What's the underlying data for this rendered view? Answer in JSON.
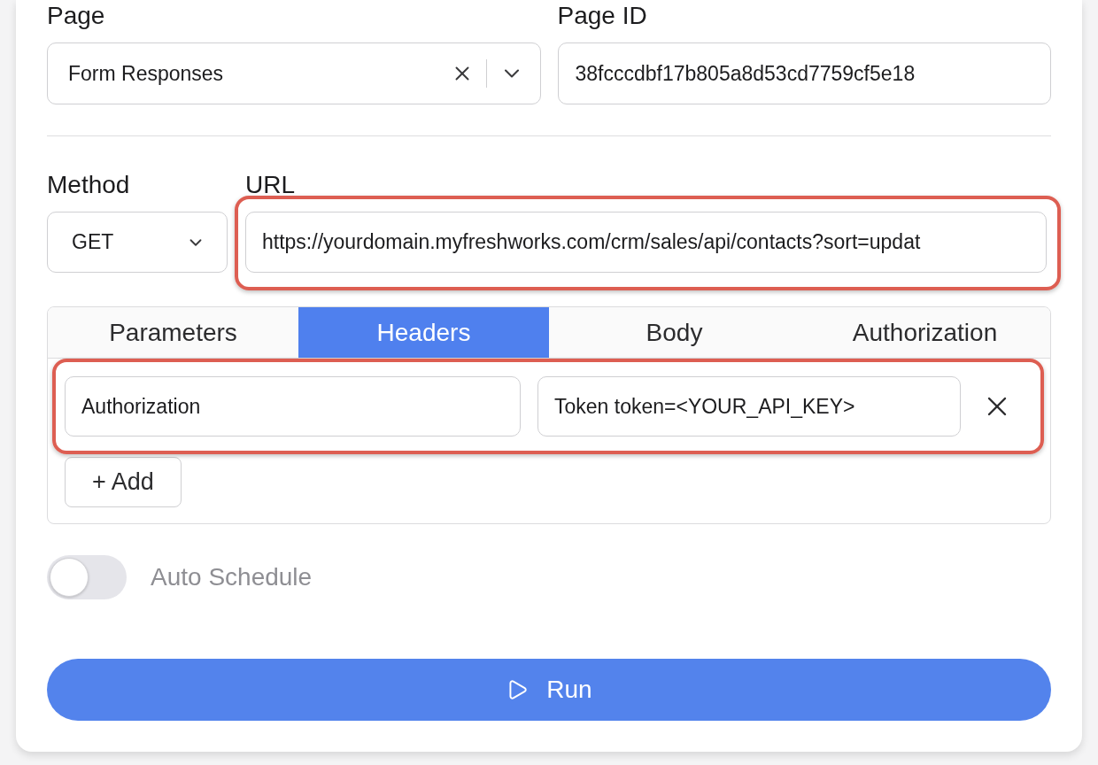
{
  "page": {
    "label": "Page",
    "value": "Form Responses"
  },
  "page_id": {
    "label": "Page ID",
    "value": "38fcccdbf17b805a8d53cd7759cf5e18"
  },
  "method": {
    "label": "Method",
    "value": "GET"
  },
  "url": {
    "label": "URL",
    "value": "https://yourdomain.myfreshworks.com/crm/sales/api/contacts?sort=updat",
    "highlighted": true
  },
  "tabs": [
    {
      "label": "Parameters",
      "selected": false
    },
    {
      "label": "Headers",
      "selected": true
    },
    {
      "label": "Body",
      "selected": false
    },
    {
      "label": "Authorization",
      "selected": false
    }
  ],
  "headers": [
    {
      "key": "Authorization",
      "value": "Token token=<YOUR_API_KEY>",
      "highlighted": true
    }
  ],
  "add_button": {
    "label": "+ Add"
  },
  "auto_schedule": {
    "label": "Auto Schedule",
    "on": false
  },
  "run_button": {
    "label": "Run"
  }
}
